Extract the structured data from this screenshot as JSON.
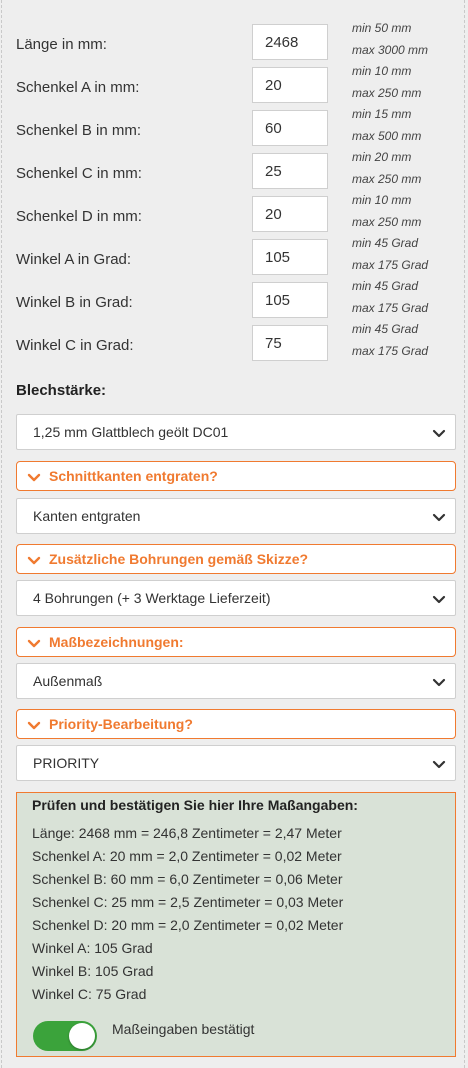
{
  "dimensions": [
    {
      "label": "Länge in mm:",
      "value": "2468",
      "min": "min 50 mm",
      "max": "max 3000 mm"
    },
    {
      "label": "Schenkel A in mm:",
      "value": "20",
      "min": "min 10 mm",
      "max": "max 250 mm"
    },
    {
      "label": "Schenkel B in mm:",
      "value": "60",
      "min": "min 15 mm",
      "max": "max 500 mm"
    },
    {
      "label": "Schenkel C in mm:",
      "value": "25",
      "min": "min 20 mm",
      "max": "max 250 mm"
    },
    {
      "label": "Schenkel D in mm:",
      "value": "20",
      "min": "min 10 mm",
      "max": "max 250 mm"
    },
    {
      "label": "Winkel A in Grad:",
      "value": "105",
      "min": "min 45 Grad",
      "max": "max 175 Grad"
    },
    {
      "label": "Winkel B in Grad:",
      "value": "105",
      "min": "min 45 Grad",
      "max": "max 175 Grad"
    },
    {
      "label": "Winkel C in Grad:",
      "value": "75",
      "min": "min 45 Grad",
      "max": "max 175 Grad"
    }
  ],
  "thickness": {
    "heading": "Blechstärke:",
    "selected": "1,25 mm Glattblech geölt DC01"
  },
  "options": [
    {
      "title": "Schnittkanten entgraten?",
      "selected": "Kanten entgraten"
    },
    {
      "title": "Zusätzliche Bohrungen gemäß Skizze?",
      "selected": "4 Bohrungen (+ 3 Werktage Lieferzeit)"
    },
    {
      "title": "Maßbezeichnungen:",
      "selected": "Außenmaß"
    },
    {
      "title": "Priority-Bearbeitung?",
      "selected": "PRIORITY"
    }
  ],
  "summary": {
    "title": "Prüfen und bestätigen Sie hier Ihre Maßangaben:",
    "lines": [
      "Länge: 2468 mm = 246,8 Zentimeter = 2,47 Meter",
      "Schenkel A: 20 mm = 2,0 Zentimeter = 0,02 Meter",
      "Schenkel B: 60 mm = 6,0 Zentimeter = 0,06 Meter",
      "Schenkel C: 25 mm = 2,5 Zentimeter = 0,03 Meter",
      "Schenkel D: 20 mm = 2,0 Zentimeter = 0,02 Meter",
      "Winkel A: 105 Grad",
      "Winkel B: 105 Grad",
      "Winkel C: 75 Grad"
    ],
    "confirm_label": "Maßeingaben bestätigt",
    "confirmed": true
  },
  "colors": {
    "accent": "#f07a30",
    "toggle_on": "#3ba33b",
    "summary_bg": "#d9e2d7",
    "page_bg": "#eeeeee"
  },
  "icons": {
    "select_arrow": "chevron-down-icon",
    "accordion_arrow": "chevron-down-icon"
  }
}
